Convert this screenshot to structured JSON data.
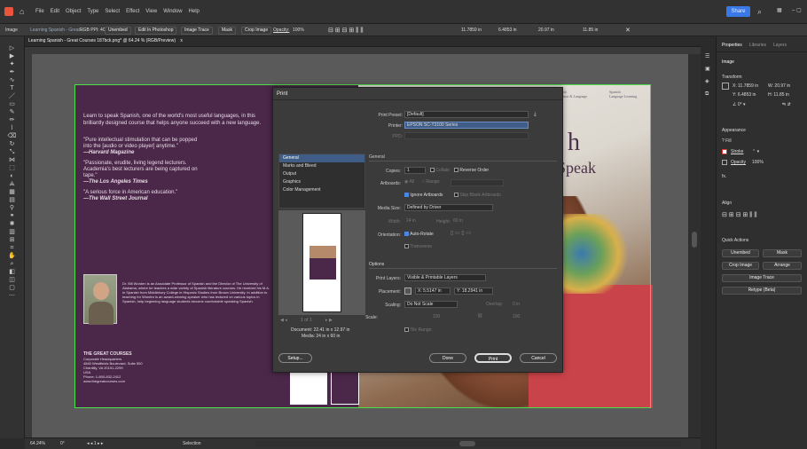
{
  "menubar": {
    "items": [
      "File",
      "Edit",
      "Object",
      "Type",
      "Select",
      "Effect",
      "View",
      "Window",
      "Help"
    ],
    "share": "Share"
  },
  "controlbar": {
    "mode": "Image",
    "file": "Learning Spanish - Great...",
    "info": "RGB PPI: 400",
    "unembed": "Unembed",
    "edit_ps": "Edit In Photoshop",
    "image_trace": "Image Trace",
    "mask": "Mask",
    "crop": "Crop Image",
    "opacity_label": "Opacity:",
    "opacity": "100%",
    "x": "11.7859 in",
    "y": "6.4853 in",
    "w": "20.97 in",
    "h": "11.85 in"
  },
  "tab": {
    "title": "Learning Spanish - Great Courses 187bck.png* @ 64.24 % (RGB/Preview)",
    "close": "x"
  },
  "status": {
    "zoom": "64.24%",
    "rotation": "0°",
    "artboard": "1",
    "tool": "Selection"
  },
  "document": {
    "left_text": [
      "Learn to speak Spanish, one of the world's most useful languages, in this",
      "brilliantly designed course that helps anyone succeed with a new language."
    ],
    "quotes": [
      {
        "q": "\"Pure intellectual stimulation that can be popped into the [audio or video player] anytime.\"",
        "src": "—Harvard Magazine"
      },
      {
        "q": "\"Passionate, erudite, living legend lecturers. Academia's best lecturers are being captured on tape.\"",
        "src": "—The Los Angeles Times"
      },
      {
        "q": "\"A serious force in American education.\"",
        "src": "—The Wall Street Journal"
      }
    ],
    "bio": "Dr. Bill Worden is an Associate Professor of Spanish and the Director of The University of Alabama, where he teaches a wide variety of Spanish literature courses. He received his M.A. in Spanish from Middlebury College in Hispanic Studies from Brown University. In addition to teaching for Worden is an award-winning speaker who has lectured on various topics in Spanish, help beginning language students become comfortable speaking Spanish.",
    "company": "THE GREAT COURSES",
    "address": [
      "Corporate Headquarters",
      "4840 Westfields Boulevard, Suite 500",
      "Chantilly, VA 20151-2299",
      "USA",
      "Phone: 1-800-832-2412",
      "www.thegreatcourses.com"
    ],
    "right_title_a": "h",
    "right_title_b": "Speak",
    "right_small": [
      "Spanish",
      "Grammar & Language",
      "Language Learning"
    ]
  },
  "dialog": {
    "title": "Print",
    "preset_label": "Print Preset:",
    "preset": "[Default]",
    "printer_label": "Printer:",
    "printer": "EPSON SC-T3100 Series",
    "ppd_label": "PPD:",
    "nav": [
      "General",
      "Marks and Bleed",
      "Output",
      "Graphics",
      "Color Management"
    ],
    "section_general": "General",
    "copies_label": "Copies:",
    "copies": "1",
    "collate": "Collate",
    "reverse": "Reverse Order",
    "artboards_label": "Artboards:",
    "all": "All",
    "range": "Range:",
    "ignore": "Ignore Artboards",
    "skip": "Skip Blank Artboards",
    "media_label": "Media Size:",
    "media": "Defined by Driver",
    "width_label": "Width:",
    "width": "24 in",
    "height_label": "Height:",
    "height": "60 in",
    "orient_label": "Orientation:",
    "autorotate": "Auto-Rotate",
    "transverse": "Transverse",
    "options": "Options",
    "layers_label": "Print Layers:",
    "layers": "Visible & Printable Layers",
    "placement_label": "Placement:",
    "px": "X: 5.5147 in",
    "py": "Y: 18.2941 in",
    "scaling_label": "Scaling:",
    "scaling": "Do Not Scale",
    "overlap_label": "Overlap:",
    "overlap": "0 in",
    "scale_label": "Scale:",
    "sw": "100",
    "sh": "100",
    "tile_range": "Tile Range:",
    "pager": "1 of 1",
    "doc_info": "Document: 22.41 in x 12.97 in",
    "media_info": "Media: 24 in x 60 in",
    "setup": "Setup...",
    "done": "Done",
    "print": "Print",
    "cancel": "Cancel"
  },
  "panel": {
    "tabs": [
      "Properties",
      "Libraries",
      "Layers"
    ],
    "image": "Image",
    "transform": "Transform",
    "x": "11.7859 in",
    "y": "6.4853 in",
    "w": "20.97 in",
    "h": "11.85 in",
    "angle": "0°",
    "appearance": "Appearance",
    "fill": "Fill",
    "stroke": "Stroke",
    "opacity": "Opacity",
    "opacity_val": "100%",
    "fx": "fx.",
    "align": "Align",
    "quick": "Quick Actions",
    "unembed": "Unembed",
    "mask": "Mask",
    "crop": "Crop Image",
    "arrange": "Arrange",
    "trace": "Image Trace",
    "retype": "Retype (Beta)"
  }
}
